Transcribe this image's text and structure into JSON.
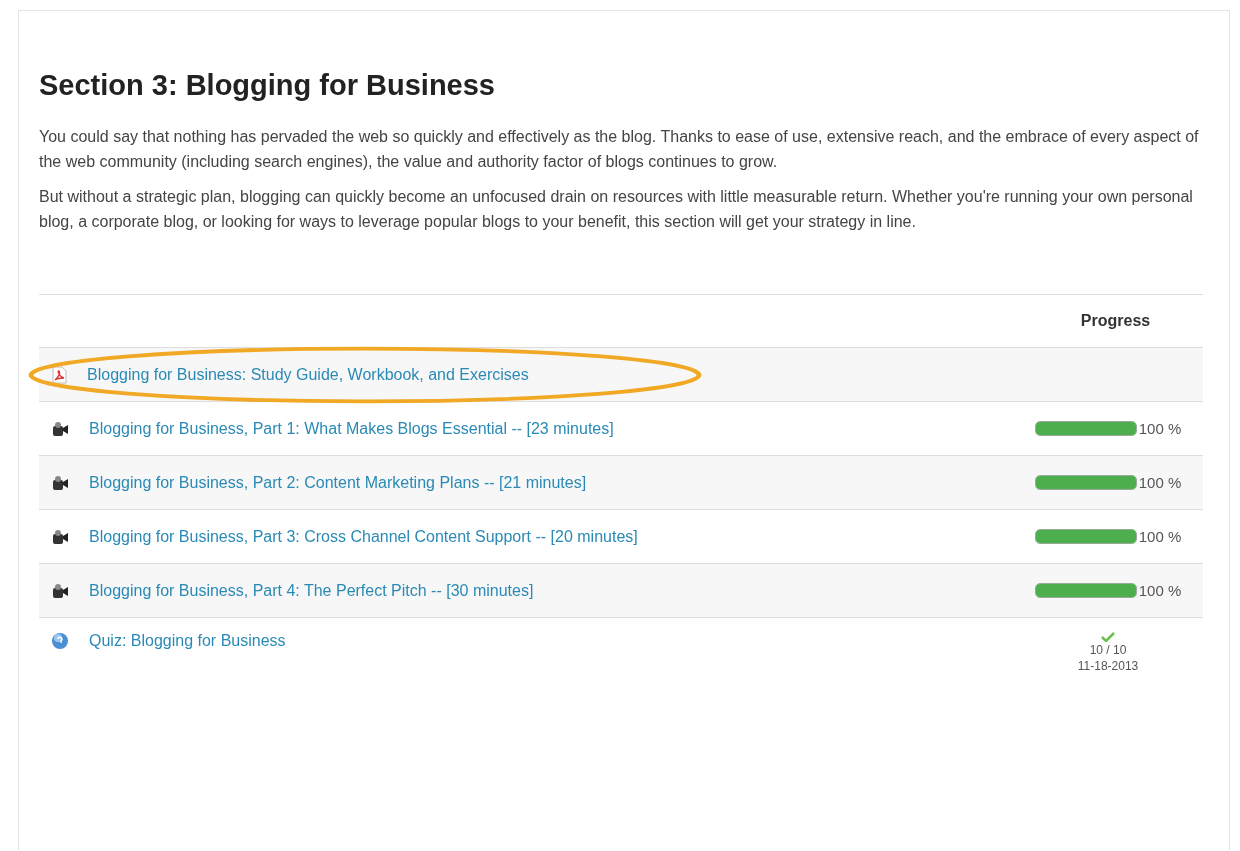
{
  "section": {
    "title": "Section 3: Blogging for Business",
    "paragraphs": [
      "You could say that nothing has pervaded the web so quickly and effectively as the blog. Thanks to ease of use, extensive reach, and the embrace of every aspect of the web community (including search engines), the value and authority factor of blogs continues to grow.",
      "But without a strategic plan, blogging can quickly become an unfocused drain on resources with little measurable return. Whether you're running your own personal blog, a corporate blog, or looking for ways to leverage popular blogs to your benefit, this section will get your strategy in line."
    ]
  },
  "table": {
    "progress_heading": "Progress",
    "rows": [
      {
        "kind": "pdf",
        "title": "Blogging for Business: Study Guide, Workbook, and Exercises",
        "highlighted": true
      },
      {
        "kind": "video",
        "title": "Blogging for Business, Part 1: What Makes Blogs Essential -- [23 minutes]",
        "highlighted": false,
        "progress": {
          "level": 1,
          "reading": "100 %"
        }
      },
      {
        "kind": "video",
        "title": "Blogging for Business, Part 2: Content Marketing Plans -- [21 minutes]",
        "highlighted": false,
        "progress": {
          "level": 1,
          "reading": "100 %"
        }
      },
      {
        "kind": "video",
        "title": "Blogging for Business, Part 3: Cross Channel Content Support -- [20 minutes]",
        "highlighted": false,
        "progress": {
          "level": 1,
          "reading": "100 %"
        }
      },
      {
        "kind": "video",
        "title": "Blogging for Business, Part 4: The Perfect Pitch -- [30 minutes]",
        "highlighted": false,
        "progress": {
          "level": 1,
          "reading": "100 %"
        }
      },
      {
        "kind": "quiz",
        "title": "Quiz: Blogging for Business",
        "highlighted": false,
        "result": {
          "passed": true,
          "score": "10 / 10",
          "date": "11-18-2013"
        }
      }
    ]
  }
}
